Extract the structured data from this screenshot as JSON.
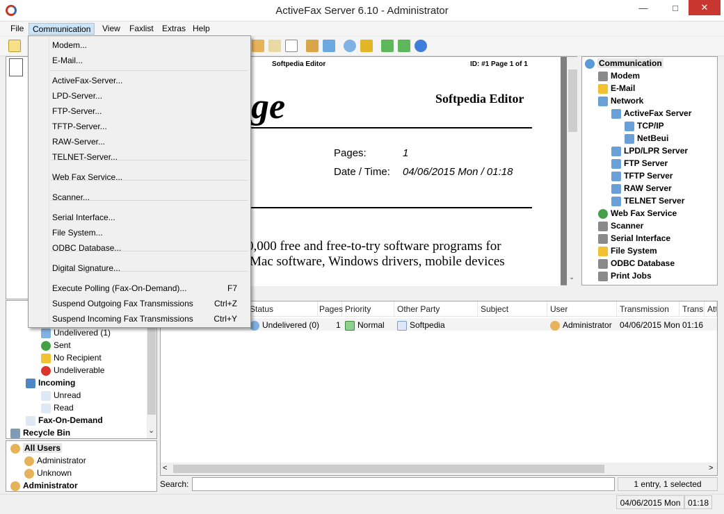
{
  "window": {
    "title": "ActiveFax Server 6.10 - Administrator"
  },
  "menubar": [
    "File",
    "Communication",
    "View",
    "Faxlist",
    "Extras",
    "Help"
  ],
  "dropdown": {
    "items": [
      {
        "label": "Modem...",
        "shortcut": ""
      },
      {
        "label": "E-Mail...",
        "shortcut": ""
      },
      {
        "label": "ActiveFax-Server...",
        "shortcut": ""
      },
      {
        "label": "LPD-Server...",
        "shortcut": ""
      },
      {
        "label": "FTP-Server...",
        "shortcut": ""
      },
      {
        "label": "TFTP-Server...",
        "shortcut": ""
      },
      {
        "label": "RAW-Server...",
        "shortcut": ""
      },
      {
        "label": "TELNET-Server...",
        "shortcut": ""
      },
      {
        "label": "Web Fax Service...",
        "shortcut": ""
      },
      {
        "label": "Scanner...",
        "shortcut": ""
      },
      {
        "label": "Serial Interface...",
        "shortcut": ""
      },
      {
        "label": "File System...",
        "shortcut": ""
      },
      {
        "label": "ODBC Database...",
        "shortcut": ""
      },
      {
        "label": "Digital Signature...",
        "shortcut": ""
      },
      {
        "label": "Execute Polling (Fax-On-Demand)...",
        "shortcut": "F7"
      },
      {
        "label": "Suspend Outgoing Fax Transmissions",
        "shortcut": "Ctrl+Z"
      },
      {
        "label": "Suspend Incoming Fax Transmissions",
        "shortcut": "Ctrl+Y"
      }
    ]
  },
  "preview": {
    "header_left": "Softpedia Editor",
    "header_right": "ID: #1   Page 1 of 1",
    "sender": "Softpedia Editor",
    "big_partial": "ge",
    "pages_label": "Pages:",
    "pages_value": "1",
    "datetime_label": "Date / Time:",
    "datetime_value": "04/06/2015 Mon / 01:18",
    "body_line1": "0,000 free and free-to-try software programs for",
    "body_line2": "Mac software, Windows drivers, mobile devices"
  },
  "right_tree": [
    {
      "label": "Communication",
      "level": 0
    },
    {
      "label": "Modem",
      "level": 1
    },
    {
      "label": "E-Mail",
      "level": 1
    },
    {
      "label": "Network",
      "level": 1
    },
    {
      "label": "ActiveFax Server",
      "level": 2
    },
    {
      "label": "TCP/IP",
      "level": 3
    },
    {
      "label": "NetBeui",
      "level": 3
    },
    {
      "label": "LPD/LPR Server",
      "level": 2
    },
    {
      "label": "FTP Server",
      "level": 2
    },
    {
      "label": "TFTP Server",
      "level": 2
    },
    {
      "label": "RAW Server",
      "level": 2
    },
    {
      "label": "TELNET Server",
      "level": 2
    },
    {
      "label": "Web Fax Service",
      "level": 1
    },
    {
      "label": "Scanner",
      "level": 1
    },
    {
      "label": "Serial Interface",
      "level": 1
    },
    {
      "label": "File System",
      "level": 1
    },
    {
      "label": "ODBC Database",
      "level": 1
    },
    {
      "label": "Print Jobs",
      "level": 1
    }
  ],
  "left_tree": [
    {
      "label": "Undelivered (1)",
      "bold": false,
      "level": 2
    },
    {
      "label": "Sent",
      "bold": false,
      "level": 2
    },
    {
      "label": "No Recipient",
      "bold": false,
      "level": 2
    },
    {
      "label": "Undeliverable",
      "bold": false,
      "level": 2
    },
    {
      "label": "Incoming",
      "bold": true,
      "level": 1
    },
    {
      "label": "Unread",
      "bold": false,
      "level": 2
    },
    {
      "label": "Read",
      "bold": false,
      "level": 2
    },
    {
      "label": "Fax-On-Demand",
      "bold": true,
      "level": 1
    },
    {
      "label": "Recycle Bin",
      "bold": true,
      "level": 0
    }
  ],
  "user_tree": [
    {
      "label": "All Users",
      "bold": true,
      "level": 0
    },
    {
      "label": "Administrator",
      "bold": false,
      "level": 1
    },
    {
      "label": "Unknown",
      "bold": false,
      "level": 1
    },
    {
      "label": "Administrator",
      "bold": true,
      "level": 0
    }
  ],
  "list": {
    "headers": [
      "Status",
      "Pages",
      "Priority",
      "Other Party",
      "Subject",
      "User",
      "Transmission Date",
      "Transm",
      "Att"
    ],
    "row": {
      "status": "Undelivered (0)",
      "pages": "1",
      "priority": "Normal",
      "other_party": "Softpedia",
      "subject": "",
      "user": "Administrator",
      "date": "04/06/2015 Mon",
      "time": "01:16"
    }
  },
  "search": {
    "label": "Search:",
    "value": ""
  },
  "entry_count": "1 entry, 1 selected",
  "status": {
    "date": "04/06/2015 Mon",
    "time": "01:18"
  }
}
